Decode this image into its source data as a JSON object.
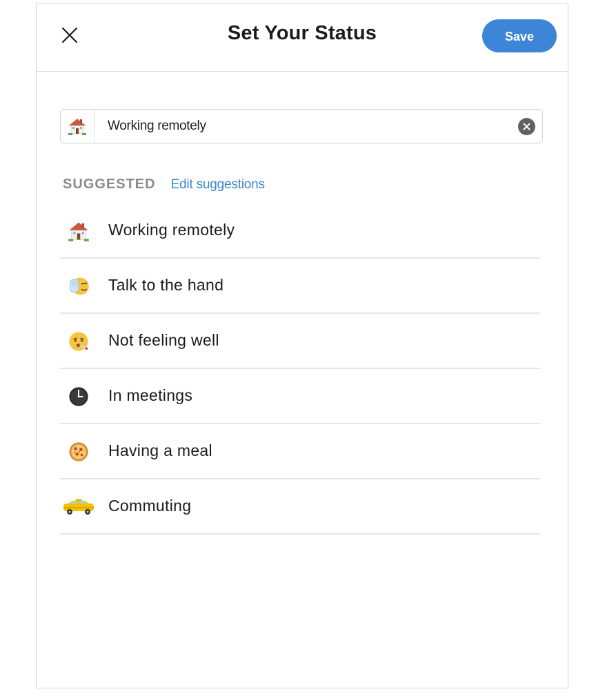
{
  "header": {
    "title": "Set Your Status",
    "save_label": "Save"
  },
  "status_input": {
    "emoji": "house-with-garden-icon",
    "value": "Working remotely"
  },
  "suggested": {
    "section_label": "SUGGESTED",
    "edit_link": "Edit suggestions",
    "items": [
      {
        "icon": "house-with-garden-icon",
        "label": "Working remotely"
      },
      {
        "icon": "raised-hand-icon",
        "label": "Talk to the hand"
      },
      {
        "icon": "face-with-thermometer-icon",
        "label": "Not feeling well"
      },
      {
        "icon": "clock-icon",
        "label": "In meetings"
      },
      {
        "icon": "pizza-icon",
        "label": "Having a meal"
      },
      {
        "icon": "taxi-icon",
        "label": "Commuting"
      }
    ]
  },
  "colors": {
    "accent": "#3d85d6",
    "link": "#3b87cc",
    "section_label": "#8a8a8a",
    "divider": "#e6e6e6"
  }
}
